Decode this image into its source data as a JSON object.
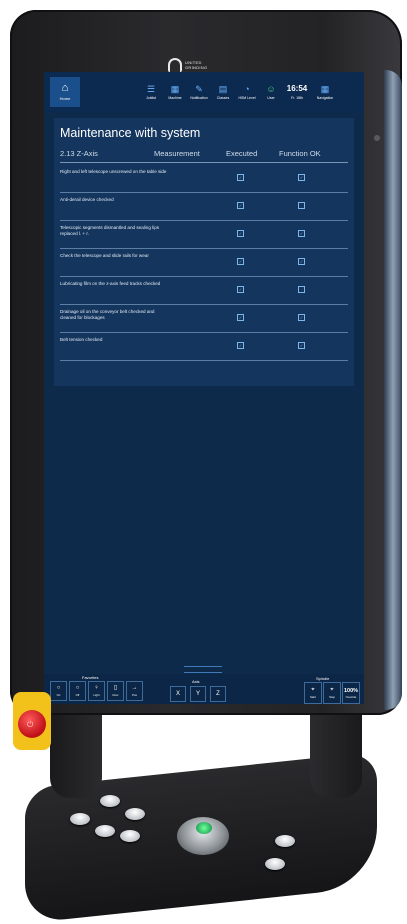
{
  "logo": {
    "text": "UNITED GRINDING"
  },
  "topbar": {
    "home_label": "Home",
    "nav": [
      {
        "icon": "joblist-icon",
        "label": "Joblist"
      },
      {
        "icon": "machine-icon",
        "label": "Machine"
      },
      {
        "icon": "notification-icon",
        "label": "Notification"
      },
      {
        "icon": "clipboard-icon",
        "label": "Classes"
      },
      {
        "icon": "gauge-icon",
        "label": "HSM Level"
      },
      {
        "icon": "user-icon",
        "label": "User"
      }
    ],
    "clock": {
      "time": "16:54",
      "date": "Fr. 18th"
    },
    "navigation_label": "Navigation"
  },
  "maintenance": {
    "title": "Maintenance with system",
    "section": "2.13 Z-Axis",
    "col_measurement": "Measurement",
    "col_executed": "Executed",
    "col_function_ok": "Function OK",
    "rows": [
      {
        "label": "Right and left telescope unscrewed on the table side",
        "executed": true,
        "function_ok": true
      },
      {
        "label": "Anti-derail device checked",
        "executed": true,
        "function_ok": false
      },
      {
        "label": "Telescopic segments dismantled and sealing lips replaced l. + r.",
        "executed": true,
        "function_ok": true
      },
      {
        "label": "Check the telescope and slide rails for wear",
        "executed": true,
        "function_ok": true
      },
      {
        "label": "Lubricating film on the z-axis feed tracks checked",
        "executed": true,
        "function_ok": false
      },
      {
        "label": "Drainage oil on the conveyor belt checked and cleaned for blockages",
        "executed": true,
        "function_ok": true
      },
      {
        "label": "Belt tension checked",
        "executed": true,
        "function_ok": true
      }
    ]
  },
  "bottombar": {
    "favorites_title": "Favorites",
    "favorites": [
      {
        "icon": "circle-icon",
        "label": "On"
      },
      {
        "icon": "circle-icon",
        "label": "Off"
      },
      {
        "icon": "lamp-icon",
        "label": "Light"
      },
      {
        "icon": "door-icon",
        "label": "Door"
      },
      {
        "icon": "arrow-icon",
        "label": "Pos"
      }
    ],
    "axis_title": "Axis",
    "axes": [
      "X",
      "Y",
      "Z"
    ],
    "spindle_title": "Spindle",
    "spindle_start": "Start",
    "spindle_stop": "Stop",
    "override_value": "100%",
    "override_label": "Override"
  }
}
